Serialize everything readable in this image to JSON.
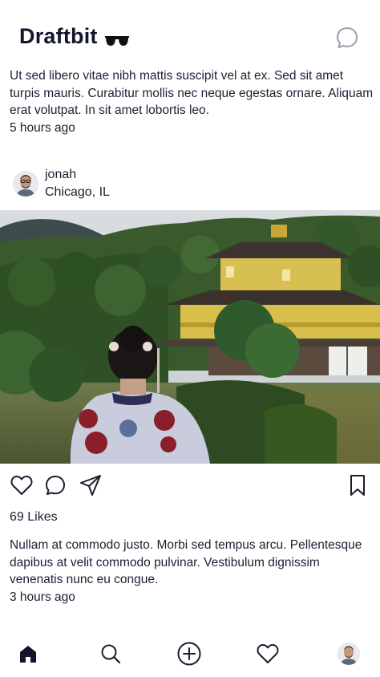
{
  "app": {
    "title": "Draftbit"
  },
  "icons": {
    "brand_emoji": "sunglasses-icon",
    "direct_message": "chat-bubble-icon",
    "like": "heart-icon",
    "comment": "comment-icon",
    "share": "send-icon",
    "save": "bookmark-icon"
  },
  "feed": {
    "post_above": {
      "caption": "Ut sed libero vitae nibh mattis suscipit vel at ex. Sed sit amet turpis mauris. Curabitur mollis nec neque egestas ornare. Aliquam erat volutpat. In sit amet lobortis leo.",
      "time": "5 hours ago"
    },
    "post": {
      "author": {
        "name": "jonah",
        "location": "Chicago, IL"
      },
      "likes": "69 Likes",
      "caption": "Nullam at commodo justo. Morbi sed tempus arcu. Pellentesque dapibus at velit commodo pulvinar. Vestibulum dignissim venenatis nunc eu congue.",
      "time": "3 hours ago"
    }
  },
  "tabbar": {
    "items": [
      {
        "name": "home",
        "icon": "home-icon",
        "active": true
      },
      {
        "name": "search",
        "icon": "search-icon",
        "active": false
      },
      {
        "name": "create",
        "icon": "plus-circle-icon",
        "active": false
      },
      {
        "name": "activity",
        "icon": "heart-icon",
        "active": false
      },
      {
        "name": "profile",
        "icon": "avatar",
        "active": false
      }
    ]
  },
  "colors": {
    "text": "#1d1f33",
    "accent": "#12152b",
    "background": "#ffffff"
  }
}
